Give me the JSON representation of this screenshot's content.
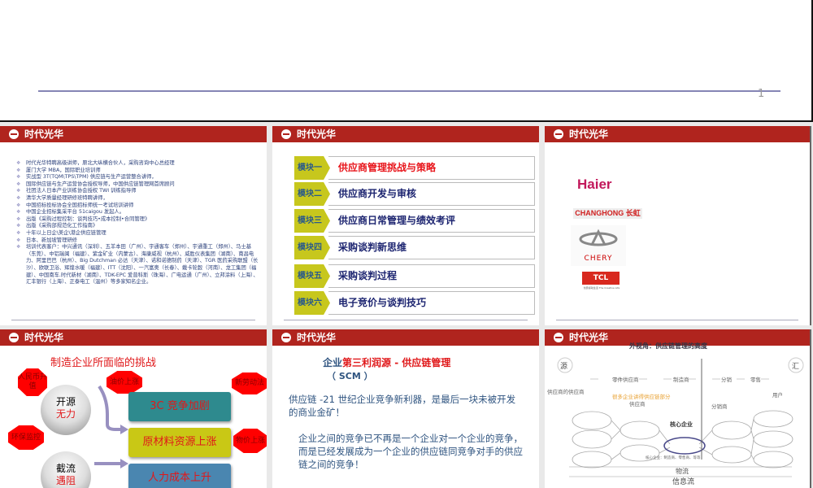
{
  "slide1": {
    "page_number": "1"
  },
  "brand": "时代光华",
  "slide2": {
    "items": [
      "时代光华特聘高级讲师，原北大纵横合伙人，采购咨询中心总经理",
      "厦门大学  MBA，国际职业培训师",
      "实战型 3T(TQM\\TPS\\TPM) 供应链与生产运营整合讲师，",
      "国际供应链与生产运营协会授权导师，中国供应链管理网首席顾问",
      "社团法人日本产业训练协会授权 TWI 训练指导师",
      "清华大学质量经理研修班特聘讲师，",
      "中国招标投标协会全国招标师统一考试培训讲师",
      "中国企业招标集采平台 51caigou 发起人。",
      "出版《采购过程控制：谈判技巧•成本控制•合同管理》",
      "出版《采购部规范化工作指南》",
      "十年以上日企\\美企\\港企供应链管理",
      "日本、新加坡管理研修",
      "培训代表客户：中兴通讯（深圳）、五羊本田（广州）、宇通客车（郑州）、宇通重工（郑州）、马士基（东莞）、中铝瑞闽（福建）、紫金矿业（内蒙古）、海康威视（杭州）、威胜仪表集团（湖南）、南昌电力、阿里巴巴（杭州）、Big Dutchman 必达（天津）、诺和诺德制药（天津）、TGR 医药采购联盟（长沙）、欧联卫浴、辉煌水暖（福建）、ITT（沈阳）、一汽富奥（长春）、戴卡轮毂（河南）、龙工集团（福建）、中国南车.时代新材（湖南）、TDK-EPC 爱普科斯（珠海）、广电运通（广州）、立邦涂料（上海）、汇丰银行（上海）、正泰电工（温州）等多家知名企业。"
    ]
  },
  "slide3": {
    "modules": [
      {
        "label": "模块一",
        "title": "供应商管理挑战与策略",
        "color": "#e8151b"
      },
      {
        "label": "模块二",
        "title": "供应商开发与审核",
        "color": "#1c2470"
      },
      {
        "label": "模块三",
        "title": "供应商日常管理与绩效考评",
        "color": "#1c2470"
      },
      {
        "label": "模块四",
        "title": "采购谈判新思维",
        "color": "#1c2470"
      },
      {
        "label": "模块五",
        "title": "采购谈判过程",
        "color": "#1c2470"
      },
      {
        "label": "模块六",
        "title": "电子竞价与谈判技巧",
        "color": "#1c2470"
      }
    ]
  },
  "slide4": {
    "logos": {
      "haier": "Haier",
      "changhong": "CHANGHONG 长虹",
      "chery": "CHERY",
      "tcl": "TCL",
      "tcl_tagline": "创意感动生活 The Creative Life"
    }
  },
  "slide5": {
    "title": "制造企业所面临的挑战",
    "octagons": [
      "人民币升值",
      "油价上涨",
      "新劳动法",
      "环保监控",
      "物价上涨"
    ],
    "spheres": [
      {
        "top": "开源",
        "bottom": "无力"
      },
      {
        "top": "截流",
        "bottom": "遇阻"
      }
    ],
    "boxes": [
      "3C 竞争加剧",
      "原材料资源上涨",
      "人力成本上升"
    ]
  },
  "slide6": {
    "title_prefix": "企业",
    "title_red": "第三利润源 - 供应链管理",
    "title_sub": "（ SCM ）",
    "para1": "供应链 -21 世纪企业竞争新利器，是最后一块未被开发的商业金矿！",
    "para2": "企业之间的竞争已不再是一个企业对一个企业的竞争，而是已经发展成为一个企业的供应链同竞争对手的供应链之间的竞争！"
  },
  "slide7": {
    "title": "外视角：供应链管理的高度",
    "source": "源",
    "sink": "汇",
    "stages": [
      "零件供应商",
      "制造商",
      "分销",
      "零售"
    ],
    "supplier_of_supplier": "供应商的供应商",
    "orange_note": "很多企业讲得供应链部分",
    "supplier": "供应商",
    "distributor": "分销商",
    "user": "用户",
    "core": "核心企业",
    "core_note": "核心企业：制造商、零售商、等等",
    "logistics": "物流",
    "info_flow": "信息流"
  }
}
